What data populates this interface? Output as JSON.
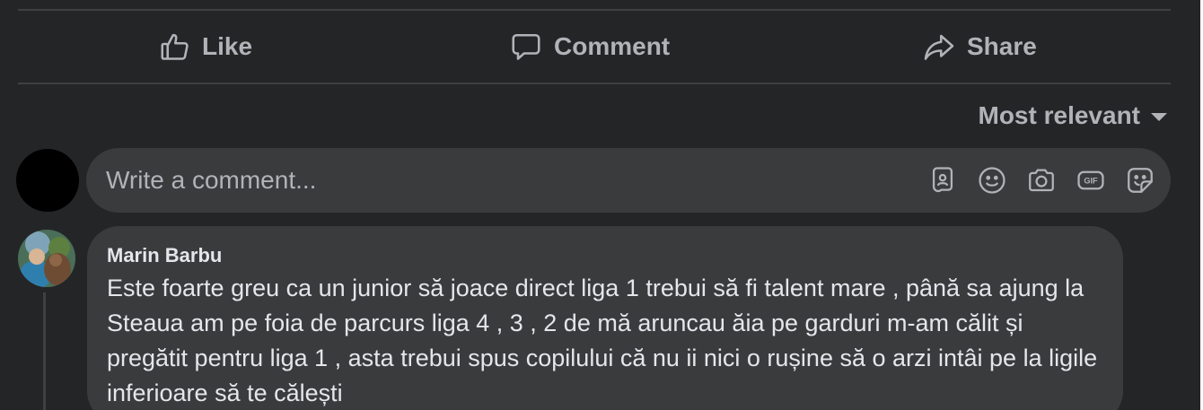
{
  "actions": {
    "like_label": "Like",
    "comment_label": "Comment",
    "share_label": "Share"
  },
  "sort": {
    "label": "Most relevant"
  },
  "composer": {
    "placeholder": "Write a comment...",
    "icons": [
      "avatar-sticker-icon",
      "emoji-icon",
      "camera-icon",
      "gif-icon",
      "sticker-icon"
    ]
  },
  "comment": {
    "author": "Marin Barbu",
    "text": "Este foarte greu ca un junior să joace direct liga 1 trebui să fi talent mare , până sa ajung la Steaua am pe foia de parcurs liga 4 , 3 , 2 de mă aruncau ăia pe garduri m-am călit și pregătit pentru liga 1 , asta trebui spus copilului că nu ii nici o rușine să o arzi intâi pe la ligile inferioare să te călești"
  },
  "colors": {
    "background": "#242526",
    "surface": "#3a3b3c",
    "divider": "#3e4042",
    "primary_text": "#e4e6eb",
    "secondary_text": "#b0b3b8"
  }
}
